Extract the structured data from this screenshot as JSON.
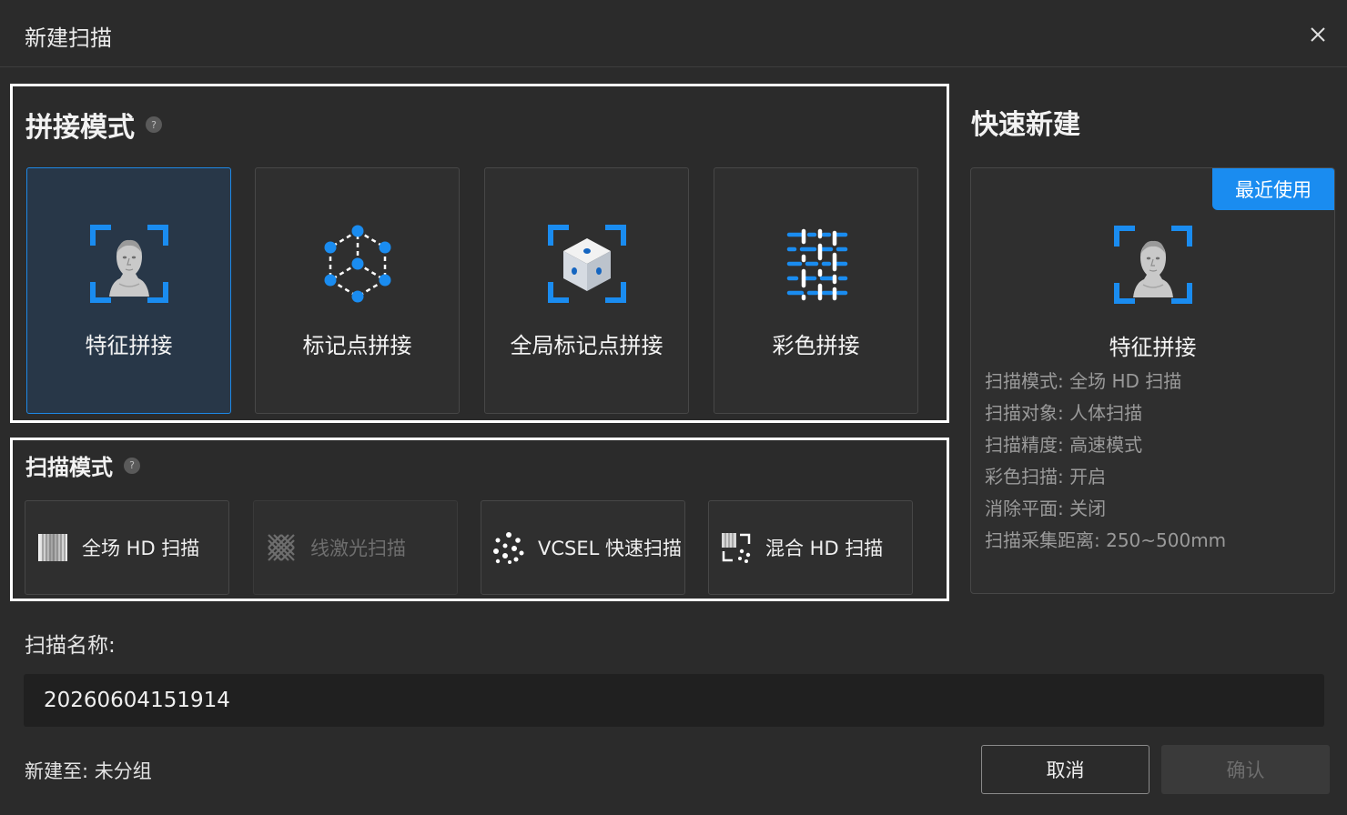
{
  "dialog": {
    "title": "新建扫描"
  },
  "stitch_mode": {
    "title": "拼接模式",
    "help": "?",
    "options": [
      {
        "label": "特征拼接",
        "icon": "bust-scan-icon",
        "selected": true
      },
      {
        "label": "标记点拼接",
        "icon": "marker-points-icon",
        "selected": false
      },
      {
        "label": "全局标记点拼接",
        "icon": "global-marker-cube-icon",
        "selected": false
      },
      {
        "label": "彩色拼接",
        "icon": "color-grid-icon",
        "selected": false
      }
    ]
  },
  "scan_mode": {
    "title": "扫描模式",
    "help": "?",
    "options": [
      {
        "label": "全场 HD 扫描",
        "icon": "fullfield-icon",
        "enabled": true
      },
      {
        "label": "线激光扫描",
        "icon": "laser-cross-icon",
        "enabled": false
      },
      {
        "label": "VCSEL 快速扫描",
        "icon": "vcsel-dots-icon",
        "enabled": true
      },
      {
        "label": "混合 HD 扫描",
        "icon": "hybrid-icon",
        "enabled": true
      }
    ]
  },
  "quick_create": {
    "title": "快速新建",
    "badge": "最近使用",
    "name": "特征拼接",
    "info": [
      "扫描模式:  全场 HD 扫描",
      "扫描对象:  人体扫描",
      "扫描精度:  高速模式",
      "彩色扫描:  开启",
      "消除平面:  关闭",
      "扫描采集距离:  250~500mm"
    ]
  },
  "scan_name": {
    "label": "扫描名称:",
    "value": "20260604151914"
  },
  "group": {
    "label": "新建至: 未分组"
  },
  "buttons": {
    "cancel": "取消",
    "confirm": "确认"
  },
  "colors": {
    "accent": "#1a8cf0",
    "selected_bg": "#283748",
    "background": "#2b2b2b"
  }
}
